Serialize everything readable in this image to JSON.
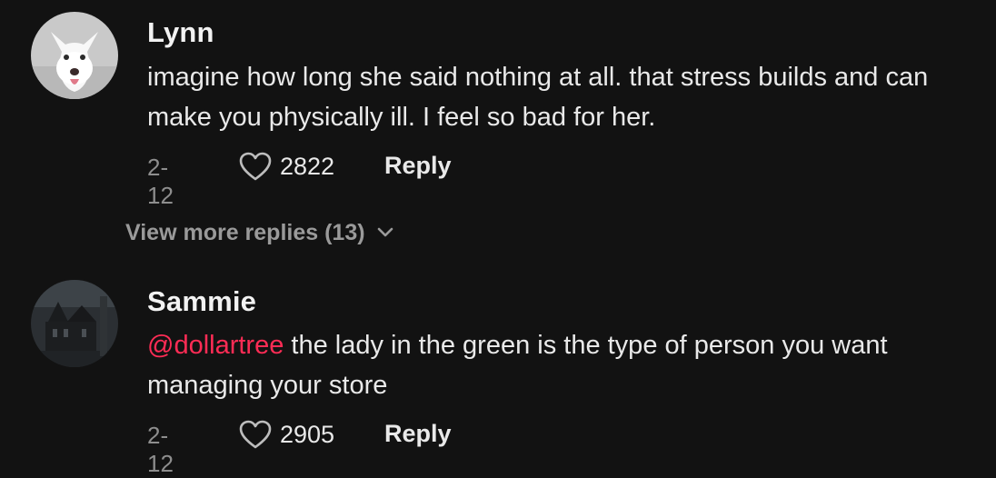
{
  "comments": [
    {
      "username": "Lynn",
      "mention": "",
      "text": "imagine how long she said nothing at all. that stress builds and can make you physically ill. I feel so bad for her.",
      "date": "2-12",
      "likes": "2822",
      "reply_label": "Reply",
      "avatar_icon": "white-dog-avatar"
    },
    {
      "username": "Sammie",
      "mention": "@dollartree",
      "text": " the lady in the green is the type of person you want managing your store",
      "date": "2-12",
      "likes": "2905",
      "reply_label": "Reply",
      "avatar_icon": "dark-house-avatar"
    }
  ],
  "view_more_label": "View more replies (13)",
  "colors": {
    "background": "#121212",
    "mention": "#fe2c55",
    "secondary_text": "#8e8e8e"
  }
}
